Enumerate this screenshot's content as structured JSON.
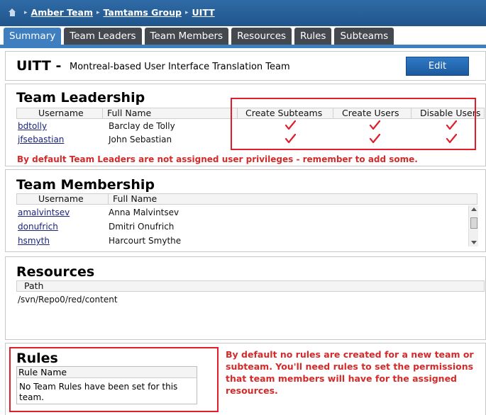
{
  "breadcrumb": {
    "items": [
      "Amber Team",
      "Tamtams Group",
      "UITT"
    ]
  },
  "tabs": [
    {
      "label": "Summary",
      "active": true
    },
    {
      "label": "Team Leaders"
    },
    {
      "label": "Team Members"
    },
    {
      "label": "Resources"
    },
    {
      "label": "Rules"
    },
    {
      "label": "Subteams"
    }
  ],
  "summary": {
    "team_name": "UITT -",
    "description": "Montreal-based User Interface Translation Team",
    "edit_label": "Edit"
  },
  "leadership": {
    "title": "Team Leadership",
    "columns": [
      "Username",
      "Full Name",
      "Create Subteams",
      "Create Users",
      "Disable Users"
    ],
    "rows": [
      {
        "username": "bdtolly",
        "full_name": "Barclay de Tolly",
        "create_subteams": true,
        "create_users": true,
        "disable_users": true
      },
      {
        "username": "jfsebastian",
        "full_name": "John Sebastian",
        "create_subteams": true,
        "create_users": true,
        "disable_users": true
      }
    ],
    "warning": "By default Team Leaders are not assigned user privileges - remember to add some."
  },
  "membership": {
    "title": "Team Membership",
    "columns": [
      "Username",
      "Full Name"
    ],
    "rows": [
      {
        "username": "amalvintsev",
        "full_name": "Anna Malvintsev"
      },
      {
        "username": "donufrich",
        "full_name": "Dmitri Onufrich"
      },
      {
        "username": "hsmyth",
        "full_name": "Harcourt Smythe"
      }
    ]
  },
  "resources": {
    "title": "Resources",
    "columns": [
      "Path"
    ],
    "rows": [
      "/svn/Repo0/red/content"
    ]
  },
  "rules": {
    "title": "Rules",
    "columns": [
      "Rule Name"
    ],
    "empty_text": "No Team Rules have been set for this team.",
    "note": "By default no rules are created for a new team or subteam. You'll need rules to set the permissions that team members will have for the assigned resources."
  },
  "colors": {
    "accent": "#3f7fc0",
    "warning": "#d32a2a",
    "check": "#e11d2b"
  }
}
